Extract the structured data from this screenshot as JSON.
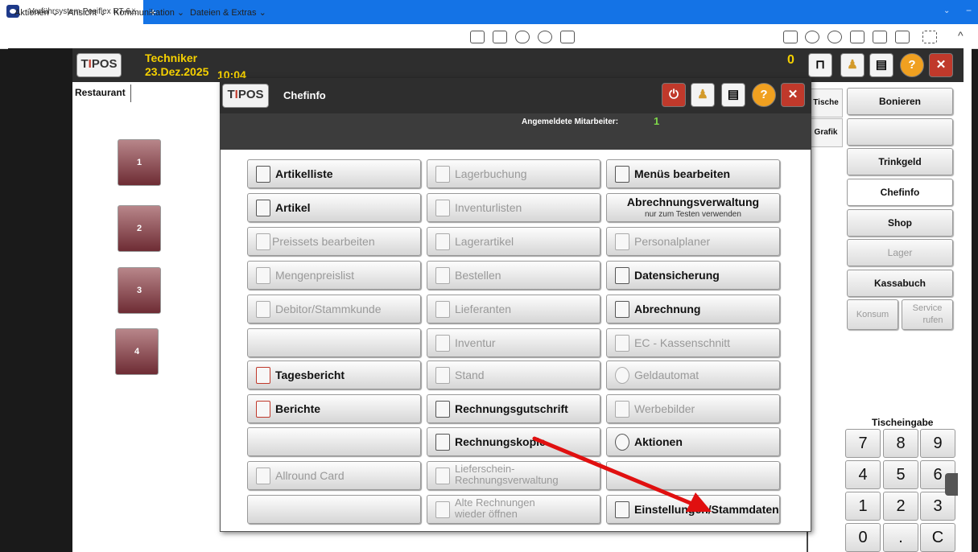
{
  "browser": {
    "tab_title": "Vorführsystem Posiflex RT-6...",
    "tab_close": "×",
    "new_tab": "+",
    "chevron": "⌄",
    "minimize": "−"
  },
  "menubar": {
    "items": [
      "Aktionen ⌄",
      "Ansicht ⌄",
      "Kommunikation ⌄",
      "Dateien & Extras ⌄"
    ]
  },
  "app": {
    "logo": "TIPOS",
    "user": "Techniker",
    "date": "23.Dez.2025",
    "time": "10:04",
    "counter": "0",
    "restaurant_tab": "Restaurant",
    "tables": [
      "1",
      "2",
      "3",
      "4"
    ],
    "side_tabs": [
      "Tische",
      "Grafik"
    ],
    "right_buttons": [
      {
        "label": "Bonieren",
        "enabled": true
      },
      {
        "label": "",
        "enabled": true
      },
      {
        "label": "Trinkgeld",
        "enabled": true
      },
      {
        "label": "Chefinfo",
        "enabled": true
      },
      {
        "label": "Shop",
        "enabled": true
      },
      {
        "label": "Lager",
        "enabled": false
      },
      {
        "label": "Kassabuch",
        "enabled": true
      }
    ],
    "konsum": "Konsum",
    "service_line1": "Service",
    "service_line2": "rufen",
    "tischeingabe": "Tischeingabe",
    "numpad": [
      "7",
      "8",
      "9",
      "4",
      "5",
      "6",
      "1",
      "2",
      "3",
      "0",
      ".",
      "C"
    ]
  },
  "dialog": {
    "logo": "TIPOS",
    "title": "Chefinfo",
    "staff_label": "Angemeldete Mitarbeiter:",
    "staff_value": "1",
    "col1": [
      {
        "label": "Artikelliste",
        "enabled": true
      },
      {
        "label": "Artikel",
        "enabled": true
      },
      {
        "label": "Preissets bearbeiten",
        "enabled": false
      },
      {
        "label": "Mengenpreislist",
        "enabled": false
      },
      {
        "label": "Debitor/Stammkunde",
        "enabled": false
      },
      {
        "label": "",
        "enabled": true
      },
      {
        "label": "Tagesbericht",
        "enabled": true
      },
      {
        "label": "Berichte",
        "enabled": true
      },
      {
        "label": "",
        "enabled": true
      },
      {
        "label": "Allround Card",
        "enabled": false
      },
      {
        "label": "",
        "enabled": true
      }
    ],
    "col2": [
      {
        "label": "Lagerbuchung",
        "enabled": false
      },
      {
        "label": "Inventurlisten",
        "enabled": false
      },
      {
        "label": "Lagerartikel",
        "enabled": false
      },
      {
        "label": "Bestellen",
        "enabled": false
      },
      {
        "label": "Lieferanten",
        "enabled": false
      },
      {
        "label": "Inventur",
        "enabled": false
      },
      {
        "label": "Stand",
        "enabled": false
      },
      {
        "label": "Rechnungsgutschrift",
        "enabled": true
      },
      {
        "label": "Rechnungskopie",
        "enabled": true
      },
      {
        "label": "Lieferschein-",
        "label2": "Rechnungsverwaltung",
        "enabled": false
      },
      {
        "label": "Alte Rechnungen",
        "label2": "wieder öffnen",
        "enabled": false
      }
    ],
    "col3": [
      {
        "label": "Menüs bearbeiten",
        "enabled": true
      },
      {
        "label": "Abrechnungsverwaltung",
        "sub": "nur zum Testen verwenden",
        "enabled": true
      },
      {
        "label": "Personalplaner",
        "enabled": false
      },
      {
        "label": "Datensicherung",
        "enabled": true
      },
      {
        "label": "Abrechnung",
        "enabled": true
      },
      {
        "label": "EC - Kassenschnitt",
        "enabled": false
      },
      {
        "label": "Geldautomat",
        "enabled": false
      },
      {
        "label": "Werbebilder",
        "enabled": false
      },
      {
        "label": "Aktionen",
        "enabled": true
      },
      {
        "label": "",
        "enabled": true
      },
      {
        "label": "Einstellungen/Stammdaten",
        "enabled": true
      }
    ]
  },
  "colors": {
    "browser_blue": "#1473e6",
    "header_dark": "#2e2e2e",
    "date_yellow": "#f5d000",
    "staff_green": "#7fd84a",
    "arrow_red": "#e01010"
  }
}
